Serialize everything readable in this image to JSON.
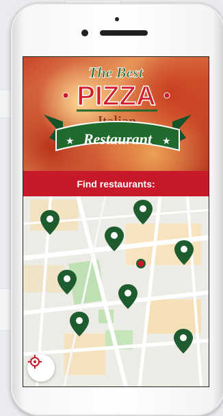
{
  "banner": {
    "line1": "The Best",
    "line2": "PIZZA",
    "line3": "Italian",
    "line4": "Restaurant"
  },
  "find_label": "Find restaurants:",
  "colors": {
    "brand_red": "#c8192a",
    "brand_green": "#1f6a2c",
    "pin_green": "#1e5b2f"
  },
  "icons": {
    "map_pin": "map-pin-icon",
    "locate": "crosshair-icon"
  }
}
